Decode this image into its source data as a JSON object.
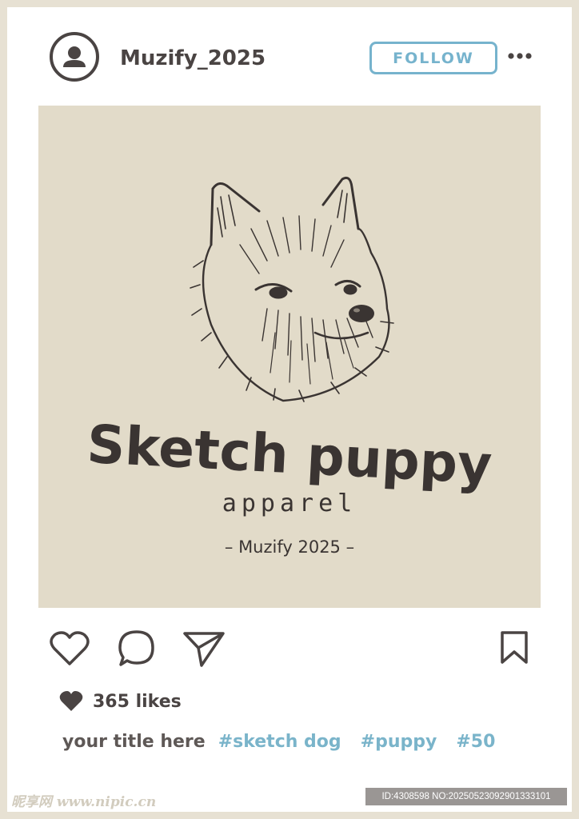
{
  "header": {
    "username": "Muzify_2025",
    "follow_label": "FOLLOW",
    "avatar_icon": "user-avatar-icon",
    "more_icon": "more-dots-icon"
  },
  "post": {
    "logo_title": "Sketch puppy",
    "logo_subtitle": "apparel",
    "logo_brand": "– Muzify 2025 –",
    "image_subject": "dog-sketch"
  },
  "actions": {
    "like_icon": "heart-icon",
    "comment_icon": "comment-bubble-icon",
    "share_icon": "send-paper-plane-icon",
    "save_icon": "bookmark-icon"
  },
  "likes": {
    "text": "365 likes"
  },
  "caption": {
    "title": "your title here",
    "tags": [
      "#sketch dog",
      "#puppy",
      "#50"
    ]
  },
  "footer": {
    "watermark": "昵享网 www.nipic.cn",
    "image_id": "ID:4308598 NO:20250523092901333101"
  },
  "colors": {
    "background": "#e7e1d3",
    "text_dark": "#4a4443",
    "accent_blue": "#76b3cd",
    "post_bg": "#e2dbc9"
  }
}
